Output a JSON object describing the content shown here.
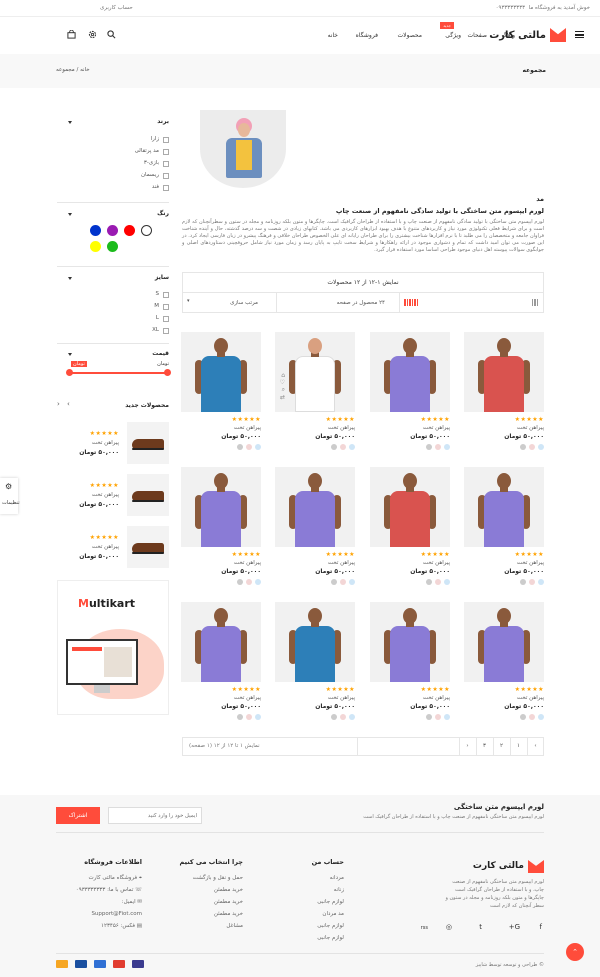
{
  "topbar": {
    "welcome": "خوش آمدید به فروشگاه ما",
    "phone": "۰۹۳۳۳۳۳۳۳۳",
    "account": "حساب کاربری"
  },
  "header": {
    "logo_text": "مالتی کارت",
    "nav": [
      "خانه",
      "فروشگاه",
      "محصولات",
      "ویژگی",
      "صفحات",
      "وبلاگ"
    ],
    "new_badge": "جدید"
  },
  "breadcrumb": {
    "page_title": "مجموعه",
    "home": "خانه",
    "separator": "/",
    "current": "مجموعه"
  },
  "sidebar": {
    "brand_title": "برند",
    "brands": [
      "زارا",
      "مد پرتقالی",
      "بازی-۳",
      "ریسمان",
      "فند"
    ],
    "color_title": "رنگ",
    "colors": [
      "#ffffff",
      "#ff0000",
      "#9a1ab2",
      "#0033cc",
      "#1cbb1c",
      "#ffff00"
    ],
    "size_title": "سایز",
    "sizes": [
      "S",
      "M",
      "L",
      "XL"
    ],
    "price_title": "قیمت",
    "price_from": "تومان",
    "price_to": "تومان",
    "new_products_title": "محصولات جدید",
    "new_products": [
      {
        "stars": "★★★★★",
        "name": "پیراهن تخت",
        "price": "۵۰,۰۰۰ تومان"
      },
      {
        "stars": "★★★★★",
        "name": "پیراهن تخت",
        "price": "۵۰,۰۰۰ تومان"
      },
      {
        "stars": "★★★★★",
        "name": "پیراهن تخت",
        "price": "۵۰,۰۰۰ تومان"
      }
    ],
    "ad_brand_m": "M",
    "ad_brand_rest": "ultikart"
  },
  "side_widget": {
    "label": "تنظیمات"
  },
  "description": {
    "title": "مد",
    "subtitle": "لورم ایپسوم متن ساختگی با تولید سادگی نامفهوم از صنعت چاپ",
    "body": "لورم ایپسوم متن ساختگی با تولید سادگی نامفهوم از صنعت چاپ و با استفاده از طراحان گرافیک است. چاپگرها و متون بلکه روزنامه و مجله در ستون و سطرآنچنان که لازم است و برای شرایط فعلی تکنولوژی مورد نیاز و کاربردهای متنوع با هدف بهبود ابزارهای کاربردی می باشد. کتابهای زیادی در شصت و سه درصد گذشته، حال و آینده شناخت فراوان جامعه و متخصصان را می طلبد تا با نرم افزارها شناخت بیشتری را برای طراحان رایانه ای علی الخصوص طراحان خلاقی و فرهنگ پیشرو در زبان فارسی ایجاد کرد. در این صورت می توان امید داشت که تمام و دشواری موجود در ارائه راهکارها و شرایط سخت تایپ به پایان رسد و زمان مورد نیاز شامل حروفچینی دستاوردهای اصلی و جوابگوی سوالات پیوسته اهل دنیای موجود طراحی اساسا مورد استفاده قرار گیرد."
  },
  "toolbar": {
    "result_count": "نمایش ۱-۱۲ از ۱۲ محصولات",
    "per_page": "۲۴ محصول در صفحه",
    "sort": "مرتب سازی"
  },
  "products": [
    {
      "stars": "★★★★★",
      "name": "پیراهن تخت",
      "price": "۵۰,۰۰۰ تومان",
      "shirt": "#d9534f",
      "kind": "man"
    },
    {
      "stars": "★★★★★",
      "name": "پیراهن تخت",
      "price": "۵۰,۰۰۰ تومان",
      "shirt": "#8a7bd6",
      "kind": "man"
    },
    {
      "stars": "★★★★★",
      "name": "پیراهن تخت",
      "price": "۵۰,۰۰۰ تومان",
      "shirt": "#ffffff",
      "kind": "woman"
    },
    {
      "stars": "★★★★★",
      "name": "پیراهن تخت",
      "price": "۵۰,۰۰۰ تومان",
      "shirt": "#2d7fb8",
      "kind": "man"
    },
    {
      "stars": "★★★★★",
      "name": "پیراهن تخت",
      "price": "۵۰,۰۰۰ تومان",
      "shirt": "#8a7bd6",
      "kind": "man"
    },
    {
      "stars": "★★★★★",
      "name": "پیراهن تخت",
      "price": "۵۰,۰۰۰ تومان",
      "shirt": "#d9534f",
      "kind": "man"
    },
    {
      "stars": "★★★★★",
      "name": "پیراهن تخت",
      "price": "۵۰,۰۰۰ تومان",
      "shirt": "#8a7bd6",
      "kind": "man"
    },
    {
      "stars": "★★★★★",
      "name": "پیراهن تخت",
      "price": "۵۰,۰۰۰ تومان",
      "shirt": "#8a7bd6",
      "kind": "man"
    },
    {
      "stars": "★★★★★",
      "name": "پیراهن تخت",
      "price": "۵۰,۰۰۰ تومان",
      "shirt": "#8a7bd6",
      "kind": "man"
    },
    {
      "stars": "★★★★★",
      "name": "پیراهن تخت",
      "price": "۵۰,۰۰۰ تومان",
      "shirt": "#8a7bd6",
      "kind": "man"
    },
    {
      "stars": "★★★★★",
      "name": "پیراهن تخت",
      "price": "۵۰,۰۰۰ تومان",
      "shirt": "#2d7fb8",
      "kind": "man"
    },
    {
      "stars": "★★★★★",
      "name": "پیراهن تخت",
      "price": "۵۰,۰۰۰ تومان",
      "shirt": "#8a7bd6",
      "kind": "man"
    }
  ],
  "pagination": {
    "pages": [
      "۱",
      "۲",
      "۳"
    ],
    "prev": "‹",
    "next": "›",
    "info": "نمایش ۱ تا ۱۲ از ۱۲ (۱ صفحه)"
  },
  "footer": {
    "newsletter_title": "لورم ایپسوم متن ساختگی",
    "newsletter_sub": "لورم ایپسوم متن ساختگی نامفهوم از صنعت چاپ و با استفاده از طراحان گرافیک است",
    "email_placeholder": "ایمیل خود را وارد کنید",
    "subscribe": "اشتراک",
    "logo_text": "مالتی کارت",
    "about": "لورم ایپسوم متن ساختگی نامفهوم از صنعت چاپ، و با استفاده از طراحان گرافیک است چاپگرها و متون بلکه روزنامه و مجله در ستون و سطر آنچنان که لازم است",
    "account_title": "حساب من",
    "account_links": [
      "مردانه",
      "زنانه",
      "لوازم جانبی",
      "مد مردان",
      "لوازم جانبی",
      "لوازم جانبی"
    ],
    "why_title": "چرا انتخاب می کنیم",
    "why_links": [
      "حمل و نقل و بازگشت",
      "خرید مطمئن",
      "خرید مطمئن",
      "خرید مطمئن",
      "مشاغل"
    ],
    "info_title": "اطلاعات فروشگاه",
    "info_lines": [
      "فروشگاه مالتی کارت",
      "تماس با ما: ۰۹۳۳۳۳۳۳۳۳",
      "ایمیل:",
      "Support@Fiot.com",
      "فکس: ۱۲۳۴۵۶"
    ],
    "social": [
      "f",
      "G+",
      "t",
      "◎",
      "rss"
    ],
    "copyright": "© طراحی و توسعه توسط شاپیز",
    "payments": [
      "visa",
      "mastercard",
      "paypal",
      "amex",
      "discover"
    ]
  }
}
